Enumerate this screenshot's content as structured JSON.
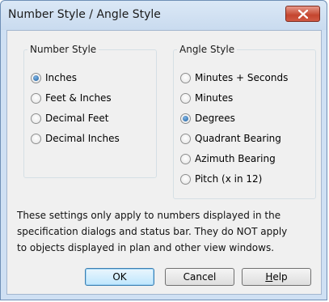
{
  "window": {
    "title": "Number Style / Angle Style"
  },
  "number_style": {
    "title": "Number Style",
    "options": [
      {
        "label": "Inches",
        "checked": true
      },
      {
        "label": "Feet & Inches",
        "checked": false
      },
      {
        "label": "Decimal Feet",
        "checked": false
      },
      {
        "label": "Decimal Inches",
        "checked": false
      }
    ]
  },
  "angle_style": {
    "title": "Angle Style",
    "options": [
      {
        "label": "Minutes + Seconds",
        "checked": false
      },
      {
        "label": "Minutes",
        "checked": false
      },
      {
        "label": "Degrees",
        "checked": true
      },
      {
        "label": "Quadrant Bearing",
        "checked": false
      },
      {
        "label": "Azimuth Bearing",
        "checked": false
      },
      {
        "label": "Pitch (x in 12)",
        "checked": false
      }
    ]
  },
  "info": {
    "line1": "These settings only apply to numbers displayed in the",
    "line2": "specification dialogs and status bar. They do NOT apply",
    "line3": "to objects displayed in plan and other view windows."
  },
  "buttons": {
    "ok": "OK",
    "cancel": "Cancel",
    "help_accel": "H",
    "help_rest": "elp"
  },
  "icons": {
    "close": "close-icon"
  }
}
